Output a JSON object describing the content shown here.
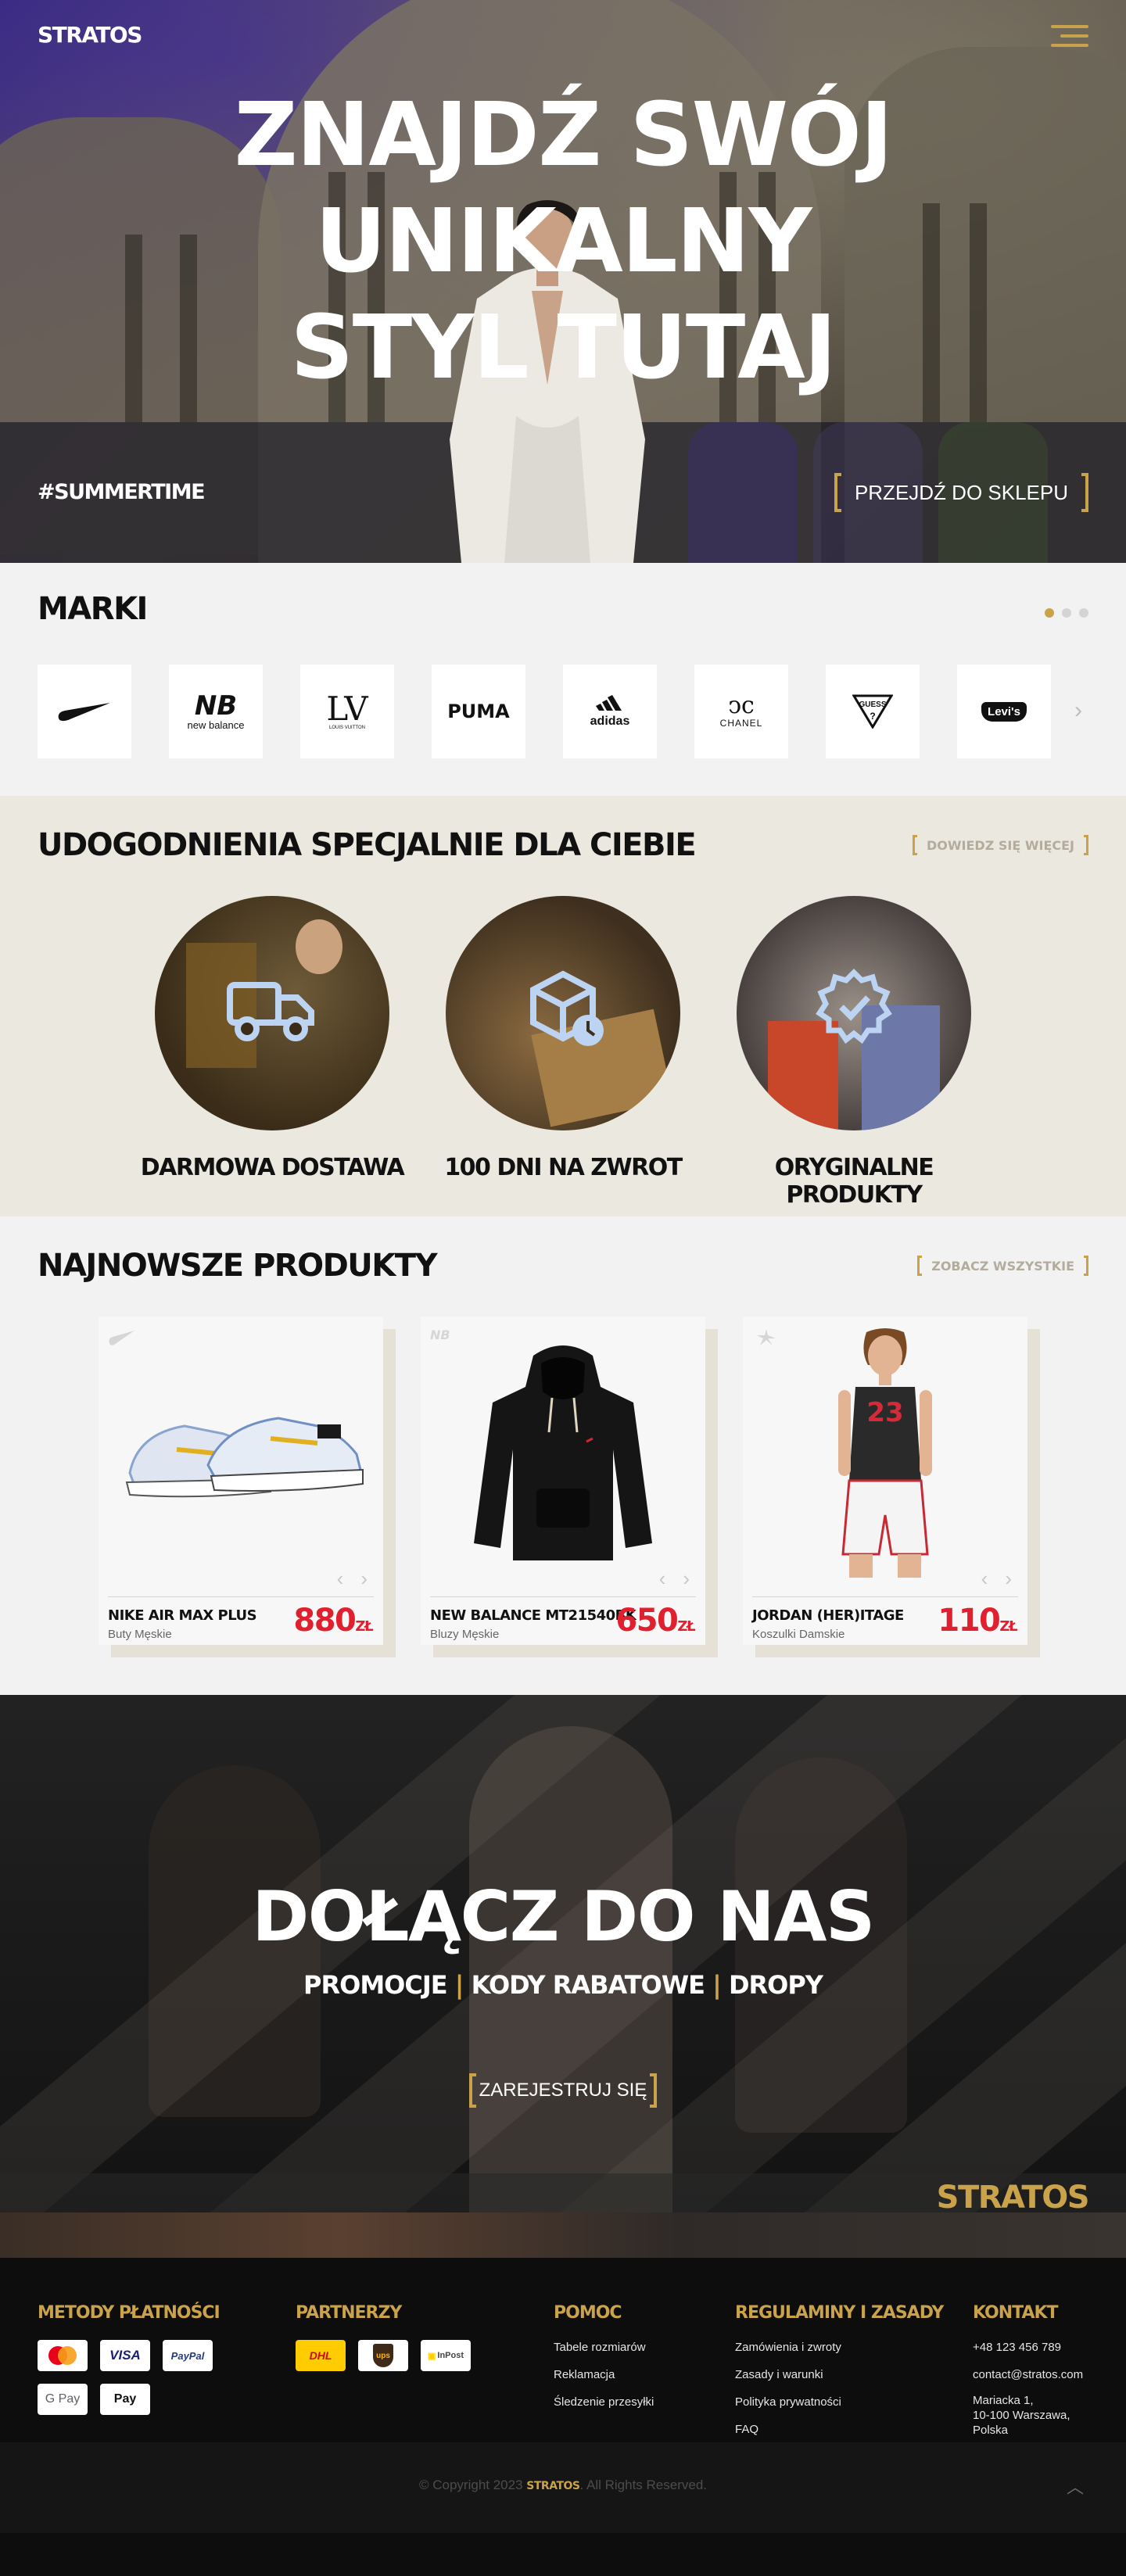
{
  "header": {
    "logo": "STRATOS",
    "headline_line1": "ZNAJDŹ SWÓJ UNIKALNY",
    "headline_line2": "STYL TUTAJ",
    "hashtag": "#SUMMERTIME",
    "cta": "PRZEJDŹ DO SKLEPU"
  },
  "brands": {
    "title": "MARKI",
    "items": [
      "nike",
      "new balance",
      "LOUIS VUITTON",
      "PUMA",
      "adidas",
      "CHANEL",
      "GUESS",
      "Levi's"
    ]
  },
  "benefits": {
    "title": "UDOGODNIENIA SPECJALNIE DLA CIEBIE",
    "link": "DOWIEDZ SIĘ WIĘCEJ",
    "items": [
      {
        "label": "DARMOWA DOSTAWA",
        "icon": "truck-icon"
      },
      {
        "label": "100 DNI NA ZWROT",
        "icon": "box-clock-icon"
      },
      {
        "label": "ORYGINALNE PRODUKTY",
        "icon": "verified-badge-icon"
      }
    ]
  },
  "products": {
    "title": "NAJNOWSZE PRODUKTY",
    "link": "ZOBACZ WSZYSTKIE",
    "currency": "zł",
    "items": [
      {
        "name": "NIKE AIR MAX PLUS",
        "category": "Buty Męskie",
        "price": "880"
      },
      {
        "name": "NEW BALANCE MT21540BK",
        "category": "Bluzy Męskie",
        "price": "650"
      },
      {
        "name": "JORDAN (HER)ITAGE",
        "category": "Koszulki Damskie",
        "price": "110"
      }
    ]
  },
  "join": {
    "title": "DOŁĄCZ DO NAS",
    "part1": "PROMOCJE",
    "part2": "KODY RABATOWE",
    "part3": "DROPY",
    "separator": "|",
    "cta": "ZAREJESTRUJ SIĘ",
    "watermark": "STRATOS"
  },
  "footer": {
    "payments_title": "METODY PŁATNOŚCI",
    "payments": [
      "mastercard",
      "VISA",
      "PayPal",
      "G Pay",
      "Apple Pay"
    ],
    "payment_labels": {
      "google": "G Pay",
      "apple": " Pay",
      "visa": "VISA",
      "paypal": "PayPal"
    },
    "partners_title": "PARTNERZY",
    "partners": {
      "dhl": "DHL",
      "ups": "ups",
      "inpost": "InPost"
    },
    "help_title": "POMOC",
    "help_links": [
      "Tabele rozmiarów",
      "Reklamacja",
      "Śledzenie przesyłki"
    ],
    "rules_title": "REGULAMINY I ZASADY",
    "rules_links": [
      "Zamówienia i zwroty",
      "Zasady i warunki",
      "Polityka prywatności",
      "FAQ"
    ],
    "contact_title": "KONTAKT",
    "phone": "+48 123 456 789",
    "email": "contact@stratos.com",
    "address1": "Mariacka 1,",
    "address2": "10-100 Warszawa,",
    "address3": "Polska",
    "copyright_pre": "© Copyright 2023",
    "copyright_brand": "STRATOS",
    "copyright_post": ". All Rights Reserved."
  },
  "colors": {
    "accent": "#c9a24a",
    "price": "#e0202e",
    "dark": "#0d0d0d"
  }
}
